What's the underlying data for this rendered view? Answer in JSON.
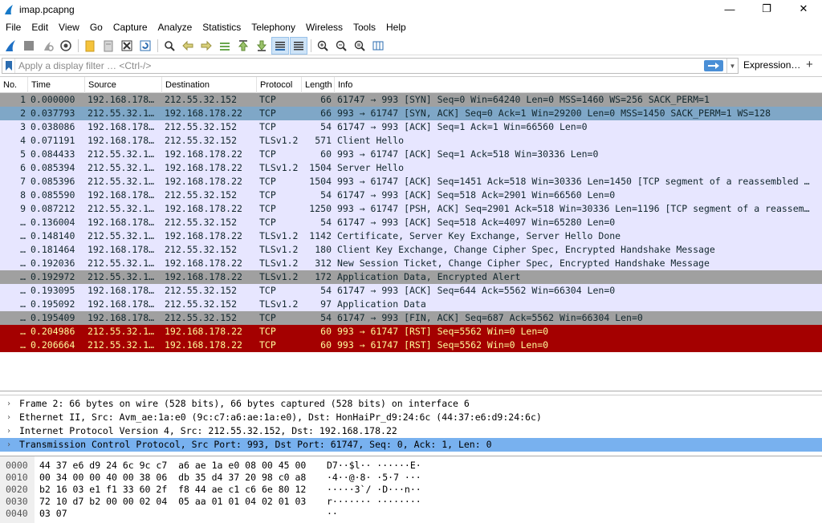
{
  "window": {
    "title": "imap.pcapng",
    "minimize": "—",
    "restore": "❐",
    "close": "✕"
  },
  "menu": [
    "File",
    "Edit",
    "View",
    "Go",
    "Capture",
    "Analyze",
    "Statistics",
    "Telephony",
    "Wireless",
    "Tools",
    "Help"
  ],
  "toolbar": {
    "icons": [
      "shark-fin-start-icon",
      "stop-square-icon",
      "restart-icon",
      "options-gear-icon",
      "open-folder-icon",
      "save-file-icon",
      "close-file-icon",
      "reload-icon",
      "find-icon",
      "go-back-icon",
      "go-forward-icon",
      "go-to-packet-icon",
      "go-first-icon",
      "go-last-icon",
      "autoscroll-icon",
      "colorize-icon",
      "zoom-in-icon",
      "zoom-out-icon",
      "zoom-normal-icon",
      "resize-columns-icon"
    ]
  },
  "filter": {
    "placeholder": "Apply a display filter … <Ctrl-/>",
    "expression_label": "Expression…",
    "plus_label": "+"
  },
  "packet_list": {
    "columns": [
      "No.",
      "Time",
      "Source",
      "Destination",
      "Protocol",
      "Length",
      "Info"
    ],
    "rows": [
      {
        "no": "1",
        "time": "0.000000",
        "src": "192.168.178…",
        "dst": "212.55.32.152",
        "proto": "TCP",
        "len": "66",
        "info": "61747 → 993 [SYN] Seq=0 Win=64240 Len=0 MSS=1460 WS=256 SACK_PERM=1",
        "style": "gray"
      },
      {
        "no": "2",
        "time": "0.037793",
        "src": "212.55.32.1…",
        "dst": "192.168.178.22",
        "proto": "TCP",
        "len": "66",
        "info": "993 → 61747 [SYN, ACK] Seq=0 Ack=1 Win=29200 Len=0 MSS=1450 SACK_PERM=1 WS=128",
        "style": "selected"
      },
      {
        "no": "3",
        "time": "0.038086",
        "src": "192.168.178…",
        "dst": "212.55.32.152",
        "proto": "TCP",
        "len": "54",
        "info": "61747 → 993 [ACK] Seq=1 Ack=1 Win=66560 Len=0",
        "style": "tcp"
      },
      {
        "no": "4",
        "time": "0.071191",
        "src": "192.168.178…",
        "dst": "212.55.32.152",
        "proto": "TLSv1.2",
        "len": "571",
        "info": "Client Hello",
        "style": "tcp"
      },
      {
        "no": "5",
        "time": "0.084433",
        "src": "212.55.32.1…",
        "dst": "192.168.178.22",
        "proto": "TCP",
        "len": "60",
        "info": "993 → 61747 [ACK] Seq=1 Ack=518 Win=30336 Len=0",
        "style": "tcp"
      },
      {
        "no": "6",
        "time": "0.085394",
        "src": "212.55.32.1…",
        "dst": "192.168.178.22",
        "proto": "TLSv1.2",
        "len": "1504",
        "info": "Server Hello",
        "style": "tcp"
      },
      {
        "no": "7",
        "time": "0.085396",
        "src": "212.55.32.1…",
        "dst": "192.168.178.22",
        "proto": "TCP",
        "len": "1504",
        "info": "993 → 61747 [ACK] Seq=1451 Ack=518 Win=30336 Len=1450 [TCP segment of a reassembled …",
        "style": "tcp"
      },
      {
        "no": "8",
        "time": "0.085590",
        "src": "192.168.178…",
        "dst": "212.55.32.152",
        "proto": "TCP",
        "len": "54",
        "info": "61747 → 993 [ACK] Seq=518 Ack=2901 Win=66560 Len=0",
        "style": "tcp"
      },
      {
        "no": "9",
        "time": "0.087212",
        "src": "212.55.32.1…",
        "dst": "192.168.178.22",
        "proto": "TCP",
        "len": "1250",
        "info": "993 → 61747 [PSH, ACK] Seq=2901 Ack=518 Win=30336 Len=1196 [TCP segment of a reassem…",
        "style": "tcp"
      },
      {
        "no": "…",
        "time": "0.136004",
        "src": "192.168.178…",
        "dst": "212.55.32.152",
        "proto": "TCP",
        "len": "54",
        "info": "61747 → 993 [ACK] Seq=518 Ack=4097 Win=65280 Len=0",
        "style": "tcp"
      },
      {
        "no": "…",
        "time": "0.148140",
        "src": "212.55.32.1…",
        "dst": "192.168.178.22",
        "proto": "TLSv1.2",
        "len": "1142",
        "info": "Certificate, Server Key Exchange, Server Hello Done",
        "style": "tcp"
      },
      {
        "no": "…",
        "time": "0.181464",
        "src": "192.168.178…",
        "dst": "212.55.32.152",
        "proto": "TLSv1.2",
        "len": "180",
        "info": "Client Key Exchange, Change Cipher Spec, Encrypted Handshake Message",
        "style": "tcp"
      },
      {
        "no": "…",
        "time": "0.192036",
        "src": "212.55.32.1…",
        "dst": "192.168.178.22",
        "proto": "TLSv1.2",
        "len": "312",
        "info": "New Session Ticket, Change Cipher Spec, Encrypted Handshake Message",
        "style": "tcp"
      },
      {
        "no": "…",
        "time": "0.192972",
        "src": "212.55.32.1…",
        "dst": "192.168.178.22",
        "proto": "TLSv1.2",
        "len": "172",
        "info": "Application Data, Encrypted Alert",
        "style": "gray"
      },
      {
        "no": "…",
        "time": "0.193095",
        "src": "192.168.178…",
        "dst": "212.55.32.152",
        "proto": "TCP",
        "len": "54",
        "info": "61747 → 993 [ACK] Seq=644 Ack=5562 Win=66304 Len=0",
        "style": "tcp"
      },
      {
        "no": "…",
        "time": "0.195092",
        "src": "192.168.178…",
        "dst": "212.55.32.152",
        "proto": "TLSv1.2",
        "len": "97",
        "info": "Application Data",
        "style": "tcp"
      },
      {
        "no": "…",
        "time": "0.195409",
        "src": "192.168.178…",
        "dst": "212.55.32.152",
        "proto": "TCP",
        "len": "54",
        "info": "61747 → 993 [FIN, ACK] Seq=687 Ack=5562 Win=66304 Len=0",
        "style": "gray"
      },
      {
        "no": "…",
        "time": "0.204986",
        "src": "212.55.32.1…",
        "dst": "192.168.178.22",
        "proto": "TCP",
        "len": "60",
        "info": "993 → 61747 [RST] Seq=5562 Win=0 Len=0",
        "style": "rst"
      },
      {
        "no": "…",
        "time": "0.206664",
        "src": "212.55.32.1…",
        "dst": "192.168.178.22",
        "proto": "TCP",
        "len": "60",
        "info": "993 → 61747 [RST] Seq=5562 Win=0 Len=0",
        "style": "rst"
      }
    ]
  },
  "details": [
    {
      "text": "Frame 2: 66 bytes on wire (528 bits), 66 bytes captured (528 bits) on interface 6",
      "selected": false
    },
    {
      "text": "Ethernet II, Src: Avm_ae:1a:e0 (9c:c7:a6:ae:1a:e0), Dst: HonHaiPr_d9:24:6c (44:37:e6:d9:24:6c)",
      "selected": false
    },
    {
      "text": "Internet Protocol Version 4, Src: 212.55.32.152, Dst: 192.168.178.22",
      "selected": false
    },
    {
      "text": "Transmission Control Protocol, Src Port: 993, Dst Port: 61747, Seq: 0, Ack: 1, Len: 0",
      "selected": true
    }
  ],
  "bytes": [
    {
      "off": "0000",
      "hex": "44 37 e6 d9 24 6c 9c c7  a6 ae 1a e0 08 00 45 00",
      "ascii": "D7··$l·· ······E·"
    },
    {
      "off": "0010",
      "hex": "00 34 00 00 40 00 38 06  db 35 d4 37 20 98 c0 a8",
      "ascii": "·4··@·8· ·5·7 ···"
    },
    {
      "off": "0020",
      "hex": "b2 16 03 e1 f1 33 60 2f  f8 44 ae c1 c6 6e 80 12",
      "ascii": "·····3`/ ·D···n··"
    },
    {
      "off": "0030",
      "hex": "72 10 d7 b2 00 00 02 04  05 aa 01 01 04 02 01 03",
      "ascii": "r······· ········"
    },
    {
      "off": "0040",
      "hex": "03 07",
      "ascii": "··"
    }
  ]
}
